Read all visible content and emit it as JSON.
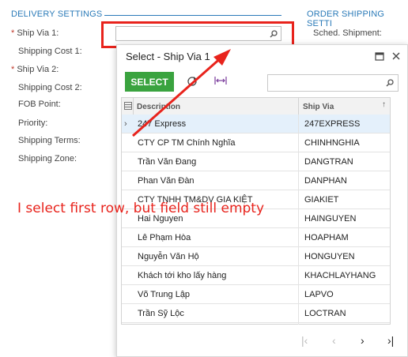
{
  "left_panel": {
    "title": "DELIVERY SETTINGS",
    "fields": [
      {
        "label": "Ship Via 1:",
        "required": "*"
      },
      {
        "label": "Shipping Cost 1:",
        "required": ""
      },
      {
        "label": "Ship Via 2:",
        "required": "*"
      },
      {
        "label": "Shipping Cost 2:",
        "required": ""
      },
      {
        "label": "FOB Point:",
        "required": ""
      },
      {
        "label": "Priority:",
        "required": ""
      },
      {
        "label": "Shipping Terms:",
        "required": ""
      },
      {
        "label": "Shipping Zone:",
        "required": ""
      }
    ],
    "ship_via_1_value": ""
  },
  "right_panel": {
    "title": "ORDER SHIPPING SETTI",
    "sched_shipment_label": "Sched. Shipment:"
  },
  "dialog": {
    "title": "Select - Ship Via 1",
    "select_button": "SELECT",
    "search_value": "",
    "columns": {
      "description": "Description",
      "ship_via": "Ship Via"
    },
    "rows": [
      {
        "description": "247 Express",
        "ship_via": "247EXPRESS"
      },
      {
        "description": "CTY CP TM Chính Nghĩa",
        "ship_via": "CHINHNGHIA"
      },
      {
        "description": "Trần Văn Đang",
        "ship_via": "DANGTRAN"
      },
      {
        "description": "Phan Văn Đàn",
        "ship_via": "DANPHAN"
      },
      {
        "description": "CTY TNHH TM&DV GIA KIỆT",
        "ship_via": "GIAKIET"
      },
      {
        "description": "Hai Nguyen",
        "ship_via": "HAINGUYEN"
      },
      {
        "description": "Lê Phạm Hòa",
        "ship_via": "HOAPHAM"
      },
      {
        "description": "Nguyễn Văn Hộ",
        "ship_via": "HONGUYEN"
      },
      {
        "description": "Khách tới kho lấy hàng",
        "ship_via": "KHACHLAYHANG"
      },
      {
        "description": "Võ Trung Lập",
        "ship_via": "LAPVO"
      },
      {
        "description": "Trần Sỹ Lộc",
        "ship_via": "LOCTRAN"
      }
    ]
  },
  "annotation": {
    "text": "I select first row, but field still empty",
    "color": "#e8231c"
  },
  "colors": {
    "accent": "#2a7ab8",
    "select_button": "#3aa33f",
    "annotation": "#e8231c"
  }
}
